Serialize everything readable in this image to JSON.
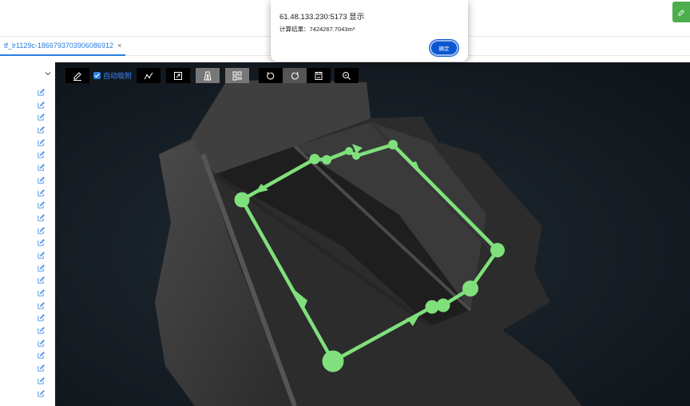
{
  "corner_button": {
    "icon": "edit-icon"
  },
  "tabs": [
    {
      "label": "tf_lr1129c-1866793703906086912",
      "close": "×"
    }
  ],
  "sidebar": {
    "collapse_icon": "chevron-down-icon",
    "item_icon": "edit-icon",
    "item_count": 25
  },
  "toolbar": {
    "buttons": [
      {
        "name": "draw-pen-button",
        "icon": "pen-icon"
      },
      {
        "name": "polyline-button",
        "icon": "polyline-icon"
      },
      {
        "name": "export-button",
        "icon": "export-icon"
      },
      {
        "name": "volume-button",
        "icon": "volume-icon"
      },
      {
        "name": "grid-button",
        "icon": "grid-icon"
      },
      {
        "name": "undo-button",
        "icon": "undo-icon"
      },
      {
        "name": "redo-button",
        "icon": "redo-icon"
      },
      {
        "name": "save-button",
        "icon": "save-icon"
      },
      {
        "name": "zoom-out-button",
        "icon": "zoom-out-icon"
      }
    ],
    "snap_checkbox": {
      "label": "自动吸附",
      "checked": true
    }
  },
  "dialog": {
    "title": "61.48.133.230:5173 显示",
    "message": "计算结果：7424267.7043m³",
    "ok_label": "确定"
  },
  "colors": {
    "accent": "#2a7de1",
    "path": "#7fe07c",
    "viewport_bg": "#141b22",
    "dialog_button": "#0b57d0"
  }
}
